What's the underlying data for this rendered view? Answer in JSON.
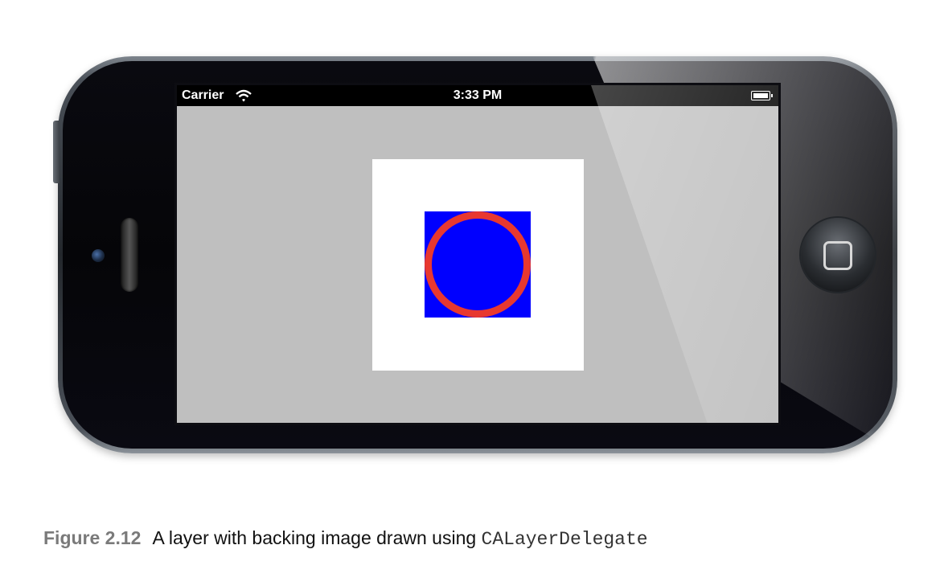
{
  "status_bar": {
    "carrier": "Carrier",
    "time": "3:33 PM",
    "wifi_icon": "wifi-icon",
    "battery_icon": "battery-icon"
  },
  "layer": {
    "background_color": "#ffffff",
    "backing_image": {
      "fill_color": "#0000ff",
      "stroke_color": "#e8382f",
      "shape": "circle"
    }
  },
  "screen_background": "#bfbfbf",
  "caption": {
    "label": "Figure 2.12",
    "text": "A layer with backing image drawn using ",
    "code": "CALayerDelegate"
  }
}
